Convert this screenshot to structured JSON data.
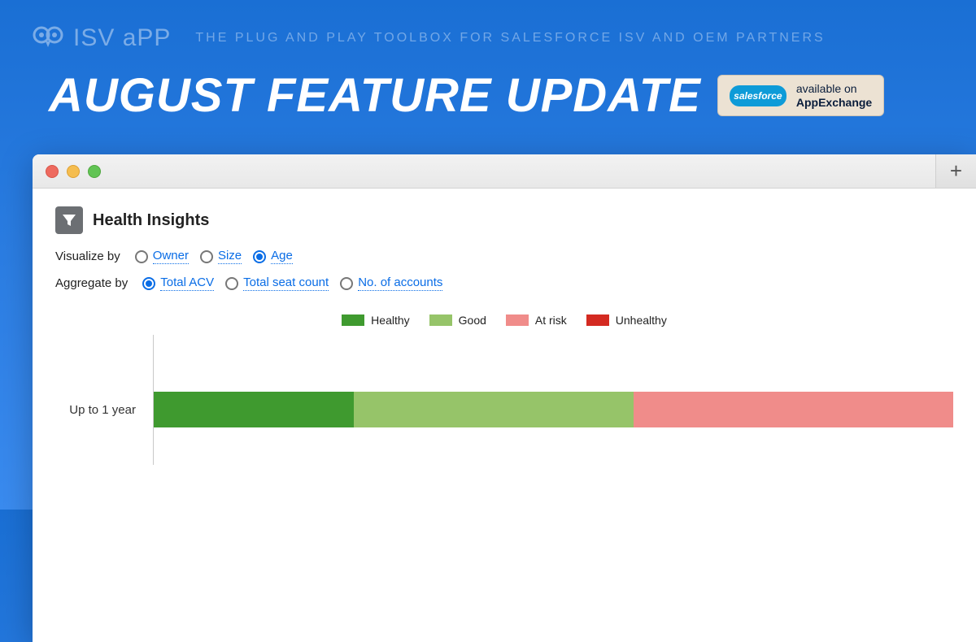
{
  "brand": {
    "logo_text": "ISV aPP",
    "tagline": "THE PLUG AND PLAY TOOLBOX FOR SALESFORCE ISV AND OEM PARTNERS"
  },
  "headline": "AUGUST FEATURE UPDATE",
  "appexchange_badge": {
    "cloud_label": "salesforce",
    "line1": "available on",
    "line2": "AppExchange"
  },
  "module": {
    "title": "Health Insights",
    "visualize_label": "Visualize by",
    "visualize_options": [
      "Owner",
      "Size",
      "Age"
    ],
    "visualize_selected": "Age",
    "aggregate_label": "Aggregate by",
    "aggregate_options": [
      "Total ACV",
      "Total seat count",
      "No. of accounts"
    ],
    "aggregate_selected": "Total ACV"
  },
  "legend": {
    "healthy": "Healthy",
    "good": "Good",
    "at_risk": "At risk",
    "unhealthy": "Unhealthy"
  },
  "chart_data": {
    "type": "bar",
    "orientation": "horizontal-stacked",
    "title": "Health Insights",
    "xlabel": "",
    "ylabel": "",
    "categories": [
      "Up to 1 year"
    ],
    "series": [
      {
        "name": "Healthy",
        "color": "#3f9a2f",
        "values": [
          25
        ]
      },
      {
        "name": "Good",
        "color": "#96c469",
        "values": [
          35
        ]
      },
      {
        "name": "At risk",
        "color": "#f08c8a",
        "values": [
          40
        ]
      },
      {
        "name": "Unhealthy",
        "color": "#d42a21",
        "values": [
          0
        ]
      }
    ],
    "xlim": [
      0,
      100
    ]
  },
  "colors": {
    "accent_blue": "#0a6de6",
    "bg_gradient_top": "#1a6fd4",
    "bg_gradient_bottom": "#3a8bef"
  }
}
